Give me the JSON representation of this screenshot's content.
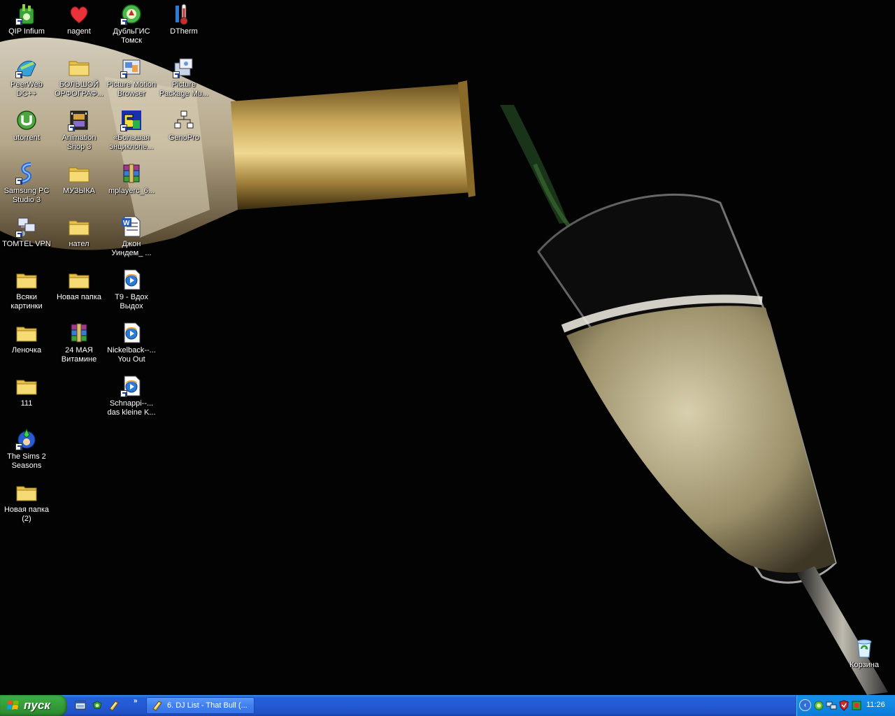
{
  "desktop_icons": [
    {
      "label": "QIP Infium",
      "icon": "qip-infium-icon"
    },
    {
      "label": "nagent",
      "icon": "heart-icon"
    },
    {
      "label": "ДубльГИС\nТомск",
      "icon": "dublgis-icon"
    },
    {
      "label": "DTherm",
      "icon": "thermometer-icon"
    },
    {
      "label": "PeerWeb\nDC++",
      "icon": "peerweb-icon"
    },
    {
      "label": "БОЛЬШОЙ\nОРФОГРАФ...",
      "icon": "folder-icon"
    },
    {
      "label": "Picture Motion\nBrowser",
      "icon": "picture-motion-icon"
    },
    {
      "label": "Picture\nPackage Mu...",
      "icon": "picture-package-icon"
    },
    {
      "label": "utorrent",
      "icon": "utorrent-icon"
    },
    {
      "label": "Animation\nShop 3",
      "icon": "film-icon"
    },
    {
      "label": "«Большая\nэнциклопе...",
      "icon": "encyclopedia-icon"
    },
    {
      "label": "GenoPro",
      "icon": "family-tree-icon"
    },
    {
      "label": "Samsung PC\nStudio 3",
      "icon": "samsung-icon"
    },
    {
      "label": "МУЗЫКА",
      "icon": "folder-icon"
    },
    {
      "label": "mplayerc_6...",
      "icon": "winrar-icon"
    },
    {
      "label": "TOMTEL VPN",
      "icon": "network-icon"
    },
    {
      "label": "нател",
      "icon": "folder-icon"
    },
    {
      "label": "Джон\nУиндем_ ...",
      "icon": "word-document-icon"
    },
    {
      "label": "Всяки\nкартинки",
      "icon": "folder-icon"
    },
    {
      "label": "Новая папка",
      "icon": "folder-icon"
    },
    {
      "label": "T9 - Вдох\nВыдох",
      "icon": "media-file-icon"
    },
    {
      "label": "Леночка",
      "icon": "folder-icon"
    },
    {
      "label": "24 МАЯ\nВитамине",
      "icon": "winrar-icon"
    },
    {
      "label": "Nickelback--...\nYou Out",
      "icon": "media-file-icon"
    },
    {
      "label": "Schnappi--...\ndas kleine K...",
      "icon": "media-file-icon"
    },
    {
      "label": "111",
      "icon": "folder-icon"
    },
    {
      "label": "The Sims 2\nSeasons",
      "icon": "sims-icon"
    },
    {
      "label": "Новая папка\n(2)",
      "icon": "folder-icon"
    }
  ],
  "recycle_bin": {
    "label": "Корзина",
    "icon": "recycle-bin-icon"
  },
  "taskbar": {
    "start_label": "пуск",
    "quick_launch": [
      "show-desktop-icon",
      "media-player-icon",
      "winamp-icon"
    ],
    "quick_launch_more": "»",
    "task_button": {
      "label": "6. DJ List - That Bull (...",
      "icon": "winamp-icon"
    },
    "tray_expand": "‹",
    "tray_icons": [
      "network-tray-icon",
      "connection-tray-icon",
      "antivirus-tray-icon",
      "security-tray-icon"
    ],
    "clock": "11:26"
  },
  "colors": {
    "taskbar_blue": "#245ad4",
    "start_green": "#37a13c",
    "tray_blue": "#118ae6",
    "wallpaper_dark": "#030303"
  }
}
